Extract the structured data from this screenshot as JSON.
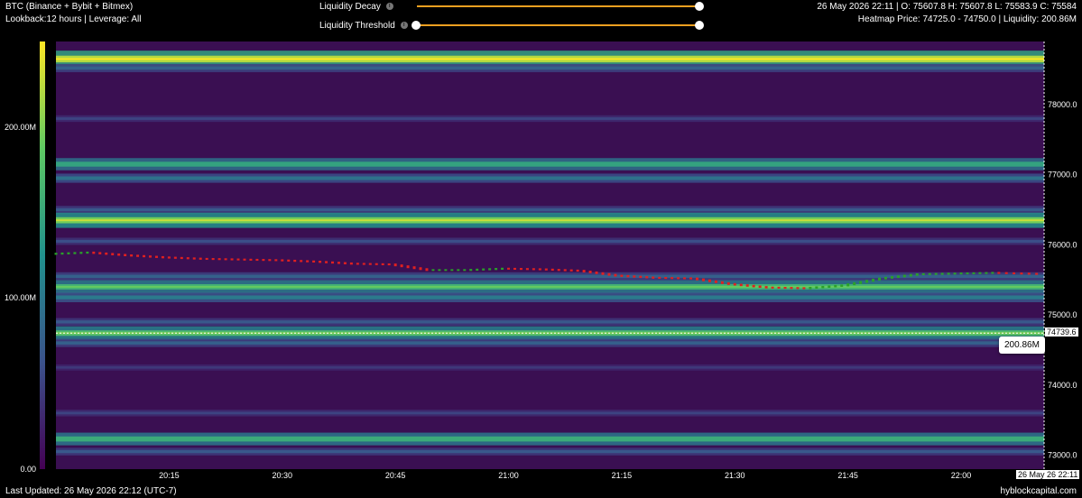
{
  "header": {
    "title": "BTC (Binance + Bybit + Bitmex)",
    "subtitle": "Lookback:12 hours | Leverage: All",
    "ohlc": "26 May 2026 22:11 | O: 75607.8 H: 75607.8 L: 75583.9 C: 75584",
    "heatmap_info": "Heatmap Price: 74725.0 - 74750.0 | Liquidity: 200.86M"
  },
  "controls": {
    "decay_label": "Liquidity Decay",
    "threshold_label": "Liquidity Threshold",
    "decay_value": 1.0,
    "threshold_range": [
      0.0,
      1.0
    ],
    "info_icon": "i"
  },
  "footer": {
    "last_updated": "Last Updated: 26 May 2026 22:12 (UTC-7)",
    "brand": "hyblockcapital.com"
  },
  "tooltip": {
    "value": "200.86M"
  },
  "colors": {
    "background": "#000000",
    "heatmap_base": "#3a0f52",
    "candle_up": "#2aa02a",
    "candle_down": "#e02020",
    "slider": "#f0a020"
  },
  "chart_data": {
    "type": "heatmap",
    "colorbar": {
      "ticks": [
        "0.00",
        "100.00M",
        "200.00M"
      ],
      "range": [
        0,
        250
      ]
    },
    "x_ticks": [
      "20:15",
      "20:30",
      "20:45",
      "21:00",
      "21:15",
      "21:30",
      "21:45",
      "22:00"
    ],
    "x_tick_minutes": [
      15,
      30,
      45,
      60,
      75,
      90,
      105,
      120
    ],
    "x_range_minutes": [
      0,
      131
    ],
    "current_x_label": "26 May 26 22:11",
    "y_ticks": [
      73000,
      74000,
      75000,
      76000,
      77000,
      78000
    ],
    "y_range": [
      72800,
      78900
    ],
    "current_price_label": "74739.6",
    "current_price": 74739.6,
    "bands": [
      {
        "price": 78650,
        "liquidity": 260
      },
      {
        "price": 78520,
        "liquidity": 90
      },
      {
        "price": 77800,
        "liquidity": 60
      },
      {
        "price": 77150,
        "liquidity": 170
      },
      {
        "price": 76950,
        "liquidity": 110
      },
      {
        "price": 76500,
        "liquidity": 80
      },
      {
        "price": 76350,
        "liquidity": 230
      },
      {
        "price": 76050,
        "liquidity": 70
      },
      {
        "price": 75550,
        "liquidity": 90
      },
      {
        "price": 75400,
        "liquidity": 190
      },
      {
        "price": 75250,
        "liquidity": 120
      },
      {
        "price": 74900,
        "liquidity": 80
      },
      {
        "price": 74740,
        "liquidity": 200.86
      },
      {
        "price": 74600,
        "liquidity": 90
      },
      {
        "price": 74250,
        "liquidity": 50
      },
      {
        "price": 73600,
        "liquidity": 60
      },
      {
        "price": 73230,
        "liquidity": 180
      },
      {
        "price": 73050,
        "liquidity": 80
      }
    ],
    "price_path": [
      [
        0,
        75870
      ],
      [
        5,
        75890
      ],
      [
        10,
        75850
      ],
      [
        15,
        75820
      ],
      [
        20,
        75800
      ],
      [
        25,
        75790
      ],
      [
        30,
        75780
      ],
      [
        35,
        75760
      ],
      [
        40,
        75730
      ],
      [
        45,
        75720
      ],
      [
        50,
        75640
      ],
      [
        55,
        75640
      ],
      [
        60,
        75660
      ],
      [
        65,
        75650
      ],
      [
        70,
        75630
      ],
      [
        75,
        75560
      ],
      [
        80,
        75530
      ],
      [
        85,
        75520
      ],
      [
        90,
        75440
      ],
      [
        95,
        75390
      ],
      [
        100,
        75380
      ],
      [
        105,
        75420
      ],
      [
        110,
        75520
      ],
      [
        115,
        75580
      ],
      [
        120,
        75590
      ],
      [
        125,
        75600
      ],
      [
        131,
        75584
      ]
    ]
  }
}
